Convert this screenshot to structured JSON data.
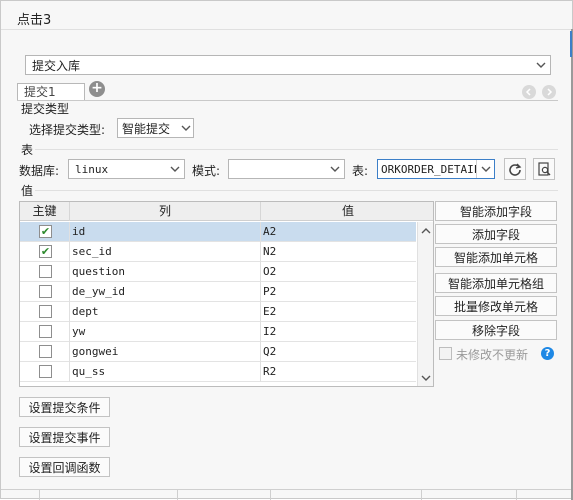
{
  "dialog": {
    "title": "点击3"
  },
  "submit_type_select": {
    "value": "提交入库",
    "arrow": "chevron-down-icon"
  },
  "tabs": [
    {
      "label": "提交1"
    }
  ],
  "section_submit_type": {
    "heading": "提交类型",
    "label": "选择提交类型:",
    "value": "智能提交"
  },
  "section_table": {
    "heading": "表",
    "db_label": "数据库:",
    "db_value": "linux",
    "schema_label": "模式:",
    "schema_value": "",
    "table_label": "表:",
    "table_value": "ORKORDER_DETAIL"
  },
  "section_values": {
    "heading": "值",
    "columns": [
      "主键",
      "列",
      "值"
    ],
    "rows": [
      {
        "key": true,
        "column": "id",
        "value": "A2",
        "selected": true
      },
      {
        "key": true,
        "column": "sec_id",
        "value": "N2",
        "selected": false
      },
      {
        "key": false,
        "column": "question",
        "value": "O2",
        "selected": false
      },
      {
        "key": false,
        "column": "de_yw_id",
        "value": "P2",
        "selected": false
      },
      {
        "key": false,
        "column": "dept",
        "value": "E2",
        "selected": false
      },
      {
        "key": false,
        "column": "yw",
        "value": "I2",
        "selected": false
      },
      {
        "key": false,
        "column": "gongwei",
        "value": "Q2",
        "selected": false
      },
      {
        "key": false,
        "column": "qu_ss",
        "value": "R2",
        "selected": false
      }
    ]
  },
  "side_buttons": {
    "smart_add_field": "智能添加字段",
    "add_field": "添加字段",
    "smart_add_cell": "智能添加单元格",
    "smart_add_cell_group": "智能添加单元格组",
    "batch_edit_cell": "批量修改单元格",
    "remove_field": "移除字段",
    "no_update_label": "未修改不更新"
  },
  "bottom_buttons": {
    "set_condition": "设置提交条件",
    "set_event": "设置提交事件",
    "set_callback": "设置回调函数"
  },
  "colors": {
    "accent": "#3c7fc8",
    "selected_row": "#c9dcee",
    "help": "#1e88e5"
  }
}
